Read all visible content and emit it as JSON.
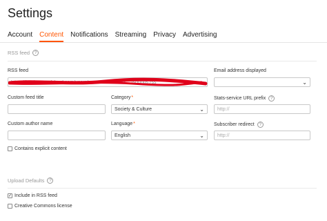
{
  "page": {
    "title": "Settings"
  },
  "tabs": [
    {
      "label": "Account",
      "active": false
    },
    {
      "label": "Content",
      "active": true
    },
    {
      "label": "Notifications",
      "active": false
    },
    {
      "label": "Streaming",
      "active": false
    },
    {
      "label": "Privacy",
      "active": false
    },
    {
      "label": "Advertising",
      "active": false
    }
  ],
  "rss_section": {
    "heading": "RSS feed",
    "rss_feed": {
      "label": "RSS feed",
      "value": "https://feeds.soundcloud.com/users/soundcloud:users:.../sounds.rss"
    },
    "email": {
      "label": "Email address displayed",
      "value": ""
    },
    "custom_title": {
      "label": "Custom feed title",
      "value": ""
    },
    "category": {
      "label": "Category",
      "required_mark": "*",
      "value": "Society & Culture"
    },
    "stats_prefix": {
      "label": "Stats-service URL prefix",
      "placeholder": "http://"
    },
    "author": {
      "label": "Custom author name",
      "value": ""
    },
    "language": {
      "label": "Language",
      "required_mark": "*",
      "value": "English"
    },
    "redirect": {
      "label": "Subscriber redirect",
      "placeholder": "http://"
    },
    "explicit": {
      "label": "Contains explicit content",
      "checked": false
    }
  },
  "upload_section": {
    "heading": "Upload Defaults",
    "include_rss": {
      "label": "Include in RSS feed",
      "checked": true
    },
    "creative_commons": {
      "label": "Creative Commons license",
      "checked": false
    }
  },
  "colors": {
    "accent": "#ff5500",
    "redaction": "#e0001a"
  }
}
